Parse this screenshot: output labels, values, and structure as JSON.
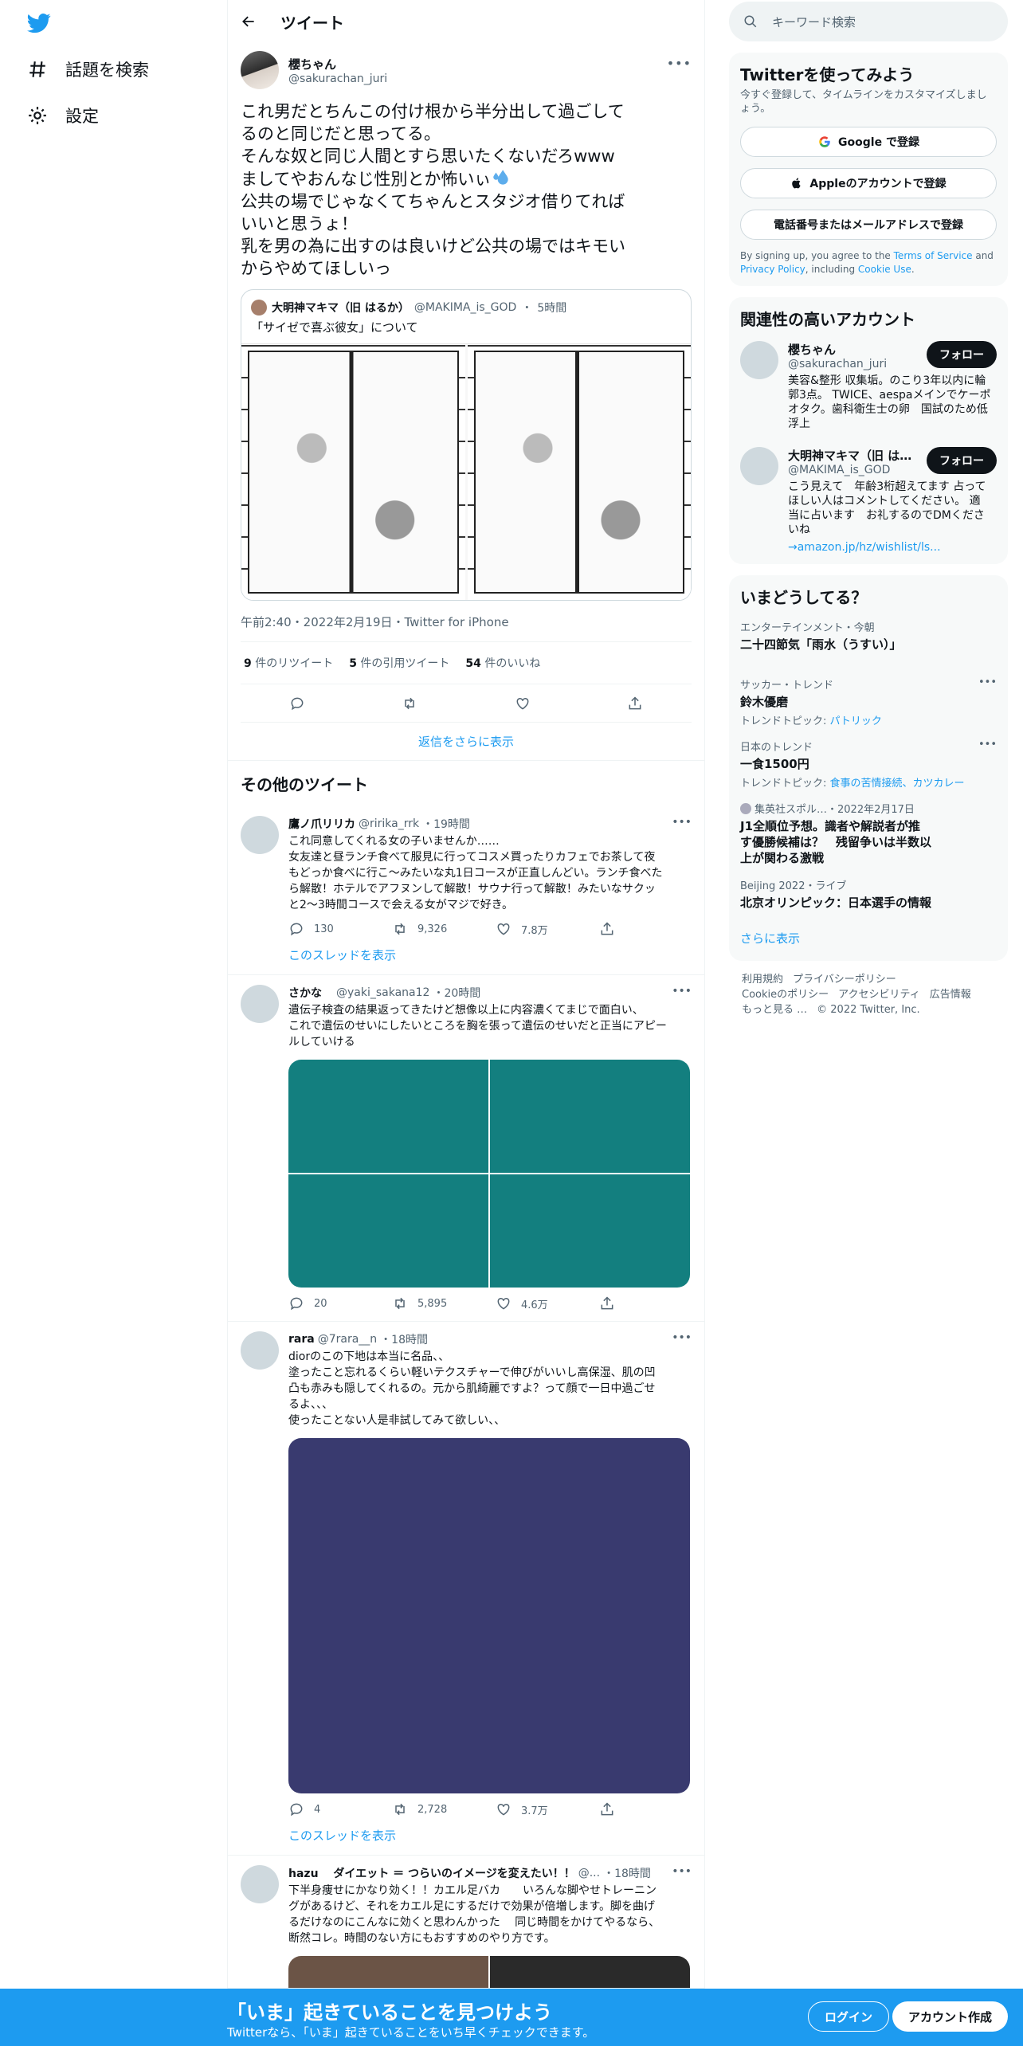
{
  "nav": {
    "explore_label": "話題を検索",
    "settings_label": "設定"
  },
  "header": {
    "title": "ツイート"
  },
  "focal": {
    "display_name": "櫻ちゃん",
    "handle": "@sakurachan_juri",
    "text_lines": [
      "これ男だとちんこの付け根から半分出して過ごして",
      "るのと同じだと思ってる。",
      "そんな奴と同じ人間とすら思いたくないだろwww",
      "ましてやおんなじ性別とか怖いぃ",
      "公共の場でじゃなくてちゃんとスタジオ借りてれば",
      "いいと思うょ！",
      "乳を男の為に出すのは良いけど公共の場ではキモい",
      "からやめてほしいっ"
    ],
    "quote": {
      "name": "大明神マキマ（旧 はるか）",
      "handle": "@MAKIMA_is_GOD",
      "time": "5時間",
      "text": "「サイゼで喜ぶ彼女」について"
    },
    "meta": "午前2:40・2022年2月19日・Twitter for iPhone",
    "retweets_count": "9",
    "retweets_label": "件のリツイート",
    "quotes_count": "5",
    "quotes_label": "件の引用ツイート",
    "likes_count": "54",
    "likes_label": "件のいいね"
  },
  "more_replies": "返信をさらに表示",
  "other_title": "その他のツイート",
  "tweets": [
    {
      "name": "鷹ノ爪リリカ",
      "handle": "@ririka_rrk",
      "time": "・19時間",
      "text": "これ同意してくれる女の子いませんか……\n女友達と昼ランチ食べて服見に行ってコスメ買ったりカフェでお茶して夜\nもどっか食べに行こ〜みたいな丸1日コースが正直しんどい。ランチ食べた\nら解散！ホテルでアフヌンして解散！サウナ行って解散！みたいなサクッ\nと2〜3時間コースで会える女がマジで好き。",
      "replies": "130",
      "retweets": "9,326",
      "likes": "7.8万",
      "thread": "このスレッドを表示"
    },
    {
      "name": "さかな",
      "handle": "@yaki_sakana12",
      "time": "・20時間",
      "text": "遺伝子検査の結果返ってきたけど想像以上に内容濃くてまじで面白い、\nこれで遺伝のせいにしたいところを胸を張って遺伝のせいだと正当にアピー\nルしていける",
      "replies": "20",
      "retweets": "5,895",
      "likes": "4.6万"
    },
    {
      "name": "rara",
      "handle": "@7rara__n",
      "time": "・18時間",
      "text": "diorのこの下地は本当に名品、、\n塗ったこと忘れるくらい軽いテクスチャーで伸びがいいし高保湿、肌の凹\n凸も赤みも隠してくれるの。元から肌綺麗ですよ？って顔で一日中過ごせ\nるよ、、、\n使ったことない人是非試してみて欲しい、、",
      "replies": "4",
      "retweets": "2,728",
      "likes": "3.7万",
      "thread": "このスレッドを表示"
    },
    {
      "name": "hazu　 ダイエット ＝ つらいのイメージを変えたい！！",
      "handle": "@...",
      "time": "・18時間",
      "text": "下半身痩せにかなり効く！！カエル足バカ　　いろんな脚やせトレーニン\nグがあるけど、それをカエル足にするだけで効果が倍増します。脚を曲げ\nるだけなのにこんなに効くと思わんかった　 同じ時間をかけてやるなら、\n断然コレ。時間のない方にもおすすめのやり方です。"
    }
  ],
  "side": {
    "search_placeholder": "キーワード検索",
    "signup_title": "Twitterを使ってみよう",
    "signup_sub": "今すぐ登録して、タイムラインをカスタマイズしましょう。",
    "google_btn": "Google で登録",
    "apple_btn": "Appleのアカウントで登録",
    "phone_btn": "電話番号またはメールアドレスで登録",
    "tos_pre": "By signing up, you agree to the ",
    "tos_terms": "Terms of Service",
    "tos_and": " and ",
    "tos_privacy": "Privacy Policy",
    "tos_including": ", including ",
    "tos_cookie": "Cookie Use",
    "tos_end": ".",
    "related_title": "関連性の高いアカウント",
    "accounts": [
      {
        "name": "櫻ちゃん",
        "handle": "@sakurachan_juri",
        "bio": "美容&整形 収集垢。のこり3年以内に輪郭3点。 TWICE、aespaメインでケーポオタク。歯科衛生士の卵　国試のため低浮上",
        "follow": "フォロー"
      },
      {
        "name": "大明神マキマ（旧 は…",
        "handle": "@MAKIMA_is_GOD",
        "bio": "こう見えて　年齢3桁超えてます 占ってほしい人はコメントしてください。 適当に占います　お礼するのでDMくださいね",
        "link": "→amazon.jp/hz/wishlist/ls...",
        "follow": "フォロー"
      }
    ],
    "trends_title": "いまどうしてる？",
    "trends": [
      {
        "cat": "エンターテインメント・今朝",
        "name": "二十四節気「雨水（うすい）」"
      },
      {
        "cat": "サッカー・トレンド",
        "name": "鈴木優磨",
        "sub_pre": "トレンドトピック: ",
        "sub_link": "パトリック"
      },
      {
        "cat": "日本のトレンド",
        "name": "一食1500円",
        "sub_pre": "トレンドトピック: ",
        "sub_link": "食事の苦情接続、カツカレー"
      },
      {
        "cat": "集英社スポル…・2022年2月17日",
        "name": "J1全順位予想。識者や解説者が推す優勝候補は？　残留争いは半数以上が関わる激戦"
      },
      {
        "cat": "Beijing 2022・ライブ",
        "name": "北京オリンピック：日本選手の情報"
      }
    ],
    "show_more": "さらに表示",
    "footer": [
      "利用規約",
      "プライバシーポリシー",
      "Cookieのポリシー",
      "アクセシビリティ",
      "広告情報",
      "もっと見る …",
      "© 2022 Twitter, Inc."
    ]
  },
  "bottom": {
    "headline": "「いま」起きていることを見つけよう",
    "sub": "Twitterなら、「いま」起きていることをいち早くチェックできます。",
    "login": "ログイン",
    "signup": "アカウント作成"
  },
  "colors": {
    "accent": "#1d9bf0",
    "text": "#0f1419",
    "muted": "#536471"
  }
}
